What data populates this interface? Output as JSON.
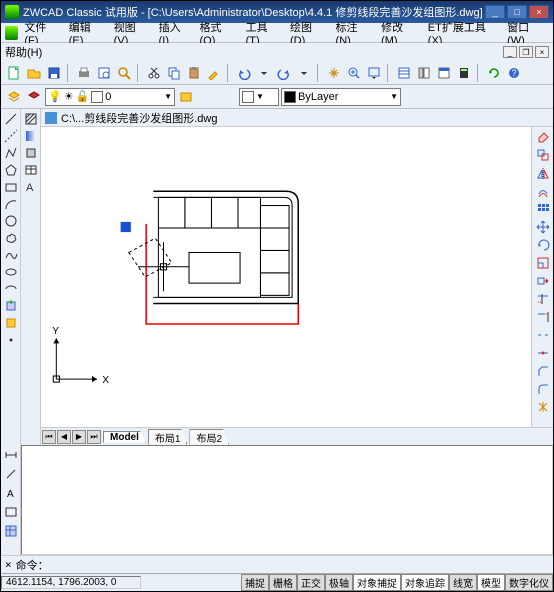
{
  "title": "ZWCAD Classic 试用版 - [C:\\Users\\Administrator\\Desktop\\4.4.1 修剪线段完善沙发组图形.dwg]",
  "menus": [
    "文件(F)",
    "编辑(E)",
    "视图(V)",
    "插入(I)",
    "格式(O)",
    "工具(T)",
    "绘图(D)",
    "标注(N)",
    "修改(M)",
    "ET扩展工具(X)",
    "窗口(W)"
  ],
  "help_menu": "帮助(H)",
  "layer_dropdown": "ByLayer",
  "zero_label": "0",
  "doc_tab": "C:\\...剪线段完善沙发组图形.dwg",
  "model_tabs": [
    "Model",
    "布局1",
    "布局2"
  ],
  "cmd_prompt": "命令：",
  "coords": "4612.1154, 1796.2003, 0",
  "status_buttons": [
    "捕捉",
    "栅格",
    "正交",
    "极轴",
    "对象捕捉",
    "对象追踪",
    "线宽",
    "模型",
    "数字化仪"
  ],
  "axis": {
    "x": "X",
    "y": "Y"
  }
}
